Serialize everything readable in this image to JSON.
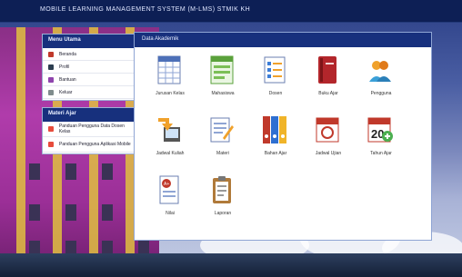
{
  "app": {
    "title": "MOBILE LEARNING MANAGEMENT SYSTEM (M-LMS) STMIK KH"
  },
  "sidebar_menu": {
    "title": "Menu Utama",
    "items": [
      {
        "label": "Beranda",
        "icon": "home-icon"
      },
      {
        "label": "Profil",
        "icon": "user-icon"
      },
      {
        "label": "Bantuan",
        "icon": "help-icon"
      },
      {
        "label": "Keluar",
        "icon": "logout-icon"
      }
    ]
  },
  "sidebar_info": {
    "title": "Materi Ajar",
    "items": [
      {
        "label": "Panduan Pengguna Data Dosen Kelas",
        "icon": "document-icon"
      },
      {
        "label": "Panduan Pengguna Aplikasi Mobile",
        "icon": "document-icon"
      }
    ]
  },
  "main": {
    "title": "Data Akademik",
    "tiles": [
      {
        "label": "Jurusan Kelas",
        "icon": "spreadsheet-icon"
      },
      {
        "label": "Mahasiswa",
        "icon": "form-icon"
      },
      {
        "label": "Dosen",
        "icon": "list-icon"
      },
      {
        "label": "Buku Ajar",
        "icon": "book-icon"
      },
      {
        "label": "Pengguna",
        "icon": "users-icon"
      },
      {
        "label": "Jadwal Kuliah",
        "icon": "import-icon"
      },
      {
        "label": "Materi",
        "icon": "edit-icon"
      },
      {
        "label": "Bahan Ajar",
        "icon": "binders-icon"
      },
      {
        "label": "Jadwal Ujian",
        "icon": "calendar-icon"
      },
      {
        "label": "Tahun Ajar",
        "icon": "calendar-20-icon"
      },
      {
        "label": "Nilai",
        "icon": "grades-icon"
      },
      {
        "label": "Laporan",
        "icon": "clipboard-icon"
      }
    ]
  },
  "colors": {
    "accent": "#17307d",
    "header_bg": "#0d1f55"
  }
}
